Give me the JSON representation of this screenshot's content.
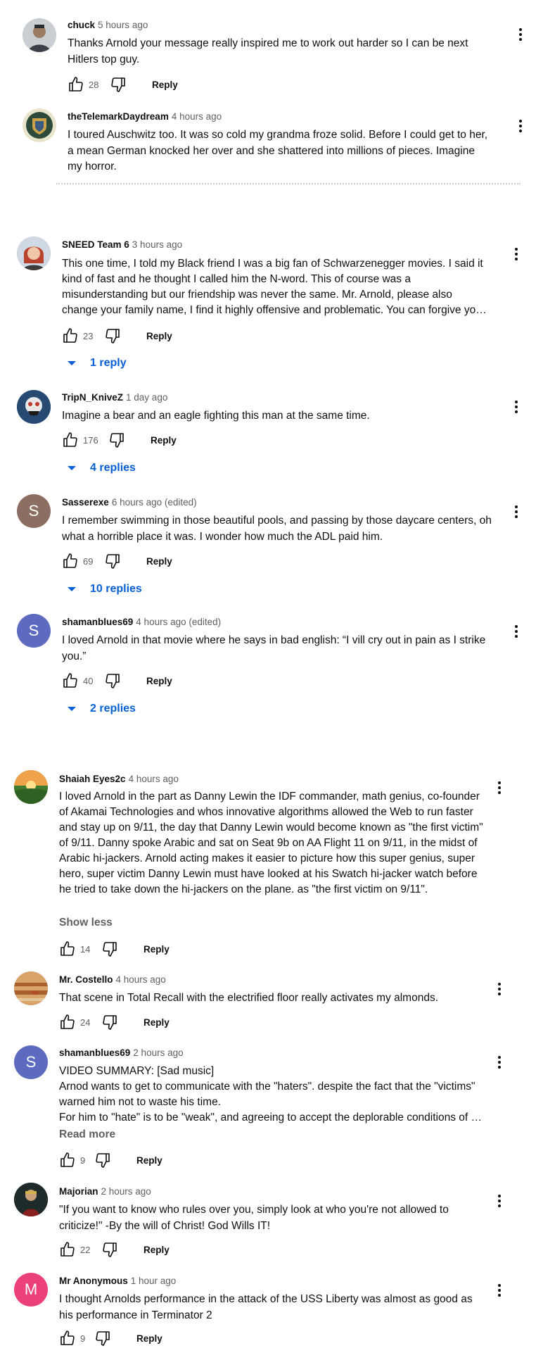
{
  "colors": {
    "accent_blue": "#065fd4",
    "text_primary": "#0f0f0f",
    "text_secondary": "#606060",
    "avatar_brown": "#8d6e63",
    "avatar_indigo": "#5c6bc0",
    "avatar_pink": "#ec407a"
  },
  "icons": {
    "like": "thumb-up-outline",
    "dislike": "thumb-down-outline",
    "menu": "three-dot-vertical",
    "expand": "caret-down"
  },
  "comments": [
    {
      "author": "chuck",
      "time": "5 hours ago",
      "text": "Thanks Arnold your message really inspired me to work out harder so I can be next Hitlers top guy.",
      "likes": "28",
      "reply": "Reply"
    },
    {
      "author": "theTelemarkDaydream",
      "time": "4 hours ago",
      "text": "I toured Auschwitz too.  It was so cold my grandma froze solid.   Before I could get to her,  a mean German knocked her over and she shattered into millions of pieces. Imagine my horror."
    },
    {
      "author": "SNEED Team 6",
      "time": "3 hours ago",
      "text_lines": [
        "This one time, I told my Black friend I was a big fan of Schwarzenegger movies. I said it",
        "kind of fast and he thought I called him the N-word. This of course was a",
        "misunderstanding but our friendship was never the same. Mr. Arnold, please also",
        "change your family name, I find it highly offensive and problematic. You can forgive yo…"
      ],
      "likes": "23",
      "reply": "Reply",
      "replies": "1 reply"
    },
    {
      "author": "TripN_KnivеZ",
      "time": "1 day ago",
      "text": "Imagine a bear and an eagle fighting this man at the same time.",
      "likes": "176",
      "reply": "Reply",
      "replies": "4 replies"
    },
    {
      "author": "Sasserexe",
      "time": "6 hours ago (edited)",
      "avatar_letter": "S",
      "text": "I remember swimming in those beautiful pools, and passing by those daycare centers, oh what a horrible place it was. I wonder how much the ADL paid him.",
      "likes": "69",
      "reply": "Reply",
      "replies": "10 replies"
    },
    {
      "author": "shamanblues69",
      "time": "4 hours ago (edited)",
      "avatar_letter": "S",
      "text": "I loved Arnold in that movie where he says in bad english: “I vill cry out in pain as I strike you.”",
      "likes": "40",
      "reply": "Reply",
      "replies": "2 replies"
    },
    {
      "author": "Shaiah Eyes2c",
      "time": "4 hours ago",
      "text": "I loved Arnold in the part as Danny Lewin the IDF commander, math genius, co-founder of Akamai Technologies and whos innovative algorithms allowed the Web to run faster and stay up on 9/11, the day that  Danny Lewin would become known as \"the first victim\" of 9/11. Danny spoke Arabic and sat on Seat 9b on AA Flight 11 on 9/11, in the midst of  Arabic hi-jackers. Arnold acting makes it easier to picture how this super genius, super hero, super victim Danny Lewin must have looked at his Swatch hi-jacker watch before he tried to take down the hi-jackers on the plane. as \"the first victim on 9/11\".",
      "show_less": "Show less",
      "likes": "14",
      "reply": "Reply"
    },
    {
      "author": "Mr. Costello",
      "time": "4 hours ago",
      "text": "That scene in Total Recall with the electrified floor really activates my almonds.",
      "likes": "24",
      "reply": "Reply"
    },
    {
      "author": "shamanblues69",
      "time": "2 hours ago",
      "avatar_letter": "S",
      "text_lines": [
        "VIDEO SUMMARY: [Sad music]",
        "Arnod wants to get to communicate with the \"haters\". despite the fact that the \"victims\"",
        "warned him not to waste his time.",
        "For him to \"hate\" is to be \"weak\", and agreeing to accept the deplorable conditions of …"
      ],
      "read_more": "Read more",
      "likes": "9",
      "reply": "Reply"
    },
    {
      "author": "Majorian",
      "time": "2 hours ago",
      "text": "\"If you want to know who rules over you, simply look at who you're not allowed to criticize!\" -By the will of Christ! God Wills IT!",
      "likes": "22",
      "reply": "Reply"
    },
    {
      "author": "Mr Anonymous",
      "time": "1 hour ago",
      "avatar_letter": "M",
      "text": "I thought Arnolds performance in the attack of the USS Liberty was almost as good as his performance in Terminator 2",
      "likes": "9",
      "reply": "Reply"
    }
  ]
}
